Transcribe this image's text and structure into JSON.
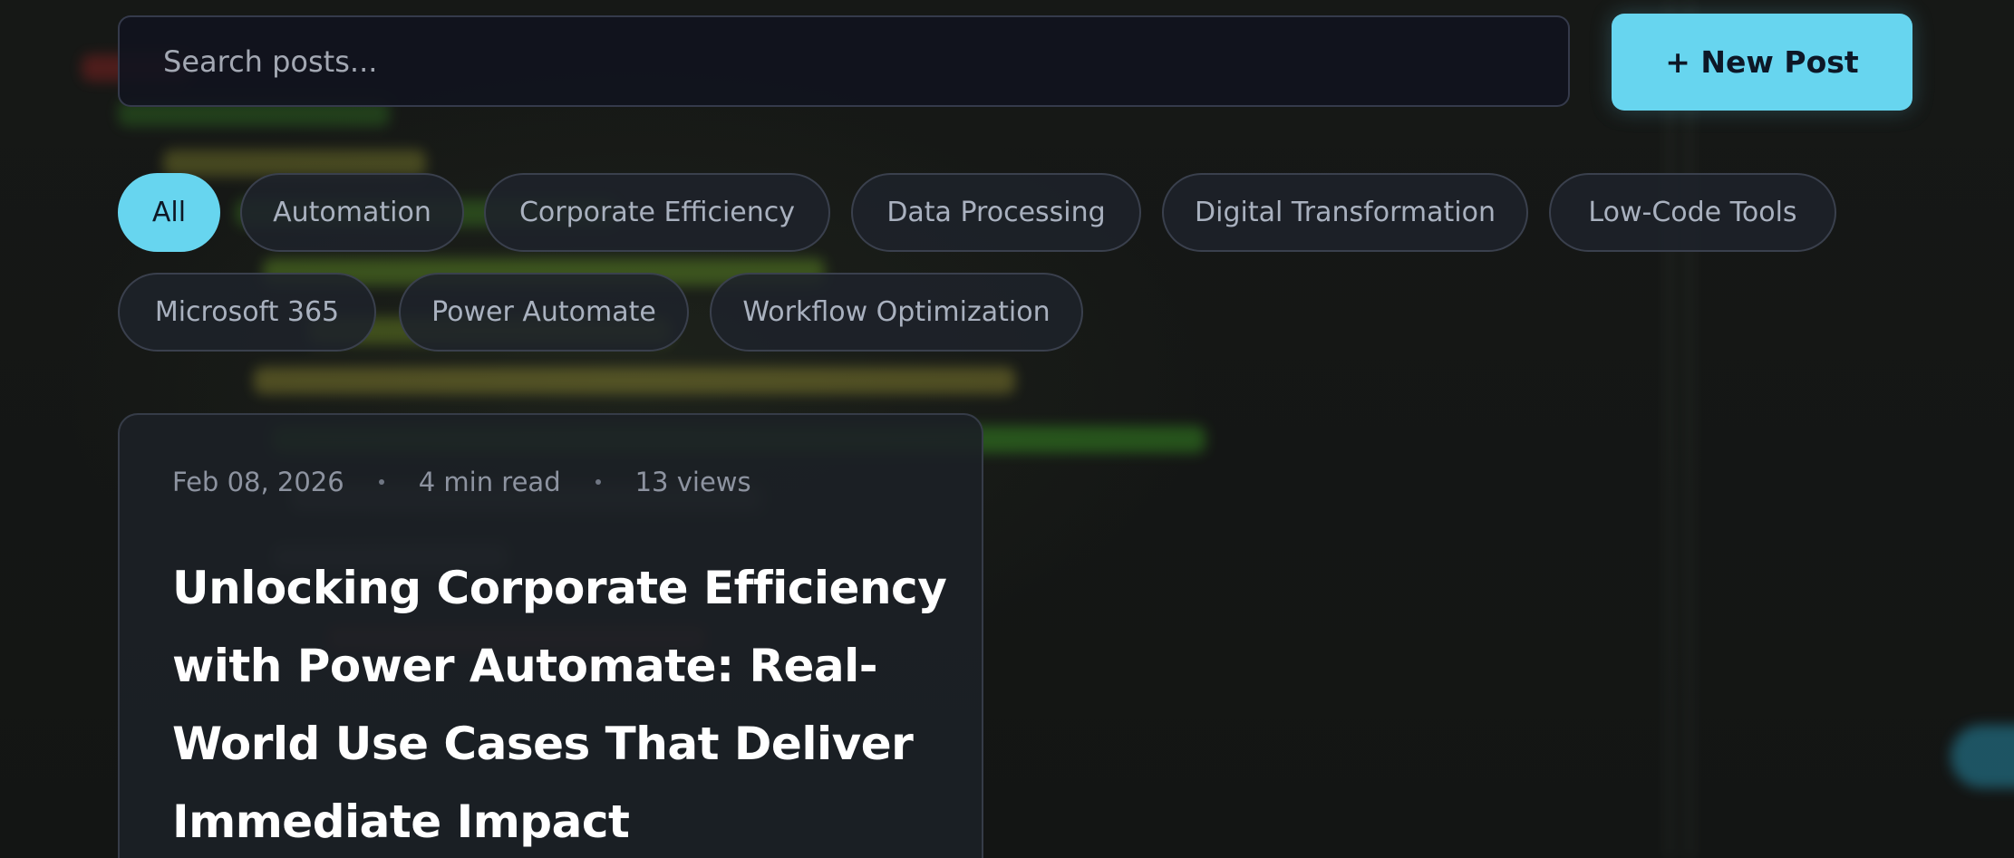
{
  "search": {
    "placeholder": "Search posts..."
  },
  "toolbar": {
    "new_post_label": "+ New Post"
  },
  "filters": [
    {
      "label": "All",
      "active": true
    },
    {
      "label": "Automation",
      "active": false
    },
    {
      "label": "Corporate Efficiency",
      "active": false
    },
    {
      "label": "Data Processing",
      "active": false
    },
    {
      "label": "Digital Transformation",
      "active": false
    },
    {
      "label": "Low-Code Tools",
      "active": false
    },
    {
      "label": "Microsoft 365",
      "active": false
    },
    {
      "label": "Power Automate",
      "active": false
    },
    {
      "label": "Workflow Optimization",
      "active": false
    }
  ],
  "posts": [
    {
      "date": "Feb 08, 2026",
      "read_time": "4 min read",
      "views": "13 views",
      "title": "Unlocking Corporate Efficiency with Power Automate: Real-World Use Cases That Deliver Immediate Impact"
    }
  ],
  "colors": {
    "accent": "#67d5ef",
    "background": "#151716",
    "card": "#1c2026",
    "chip_text": "#a9b1bf"
  }
}
